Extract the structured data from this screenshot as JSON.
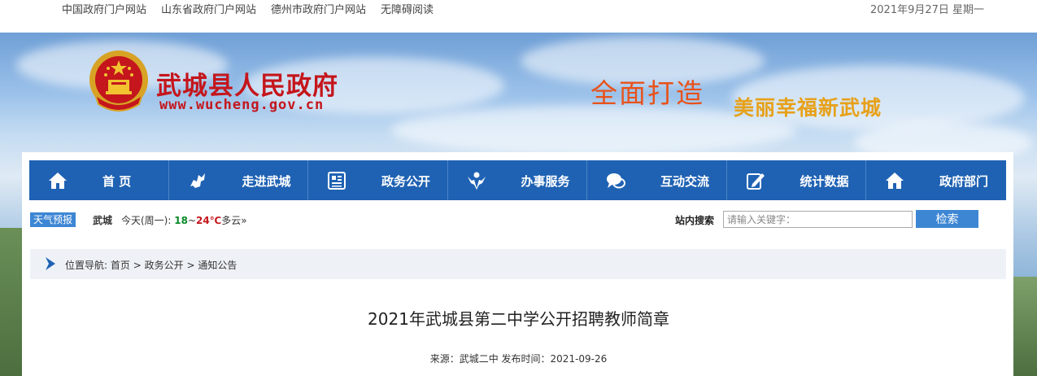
{
  "top_links": [
    "中国政府门户网站",
    "山东省政府门户网站",
    "德州市政府门户网站",
    "无障碍阅读"
  ],
  "date": "2021年9月27日 星期一",
  "site": {
    "title": "武城县人民政府",
    "url": "www.wucheng.gov.cn"
  },
  "slogan": {
    "line1": "全面打造",
    "line2": "美丽幸福新武城"
  },
  "nav": [
    {
      "label": "首 页",
      "icon": "home-icon"
    },
    {
      "label": "走进武城",
      "icon": "map-icon"
    },
    {
      "label": "政务公开",
      "icon": "document-icon"
    },
    {
      "label": "办事服务",
      "icon": "service-person-icon"
    },
    {
      "label": "互动交流",
      "icon": "chat-icon"
    },
    {
      "label": "统计数据",
      "icon": "edit-data-icon"
    },
    {
      "label": "政府部门",
      "icon": "building-icon"
    }
  ],
  "weather": {
    "tag": "天气预报",
    "city": "武城",
    "day": "今天(周一):",
    "low": "18",
    "sep": "~",
    "high": "24℃",
    "desc": "多云",
    "more": "»"
  },
  "search": {
    "label": "站内搜索",
    "placeholder": "请输入关键字：",
    "button": "检索"
  },
  "breadcrumb": {
    "prefix": "位置导航:",
    "items": [
      "首页",
      "政务公开",
      "通知公告"
    ],
    "sep": ">"
  },
  "article": {
    "title": "2021年武城县第二中学公开招聘教师简章",
    "meta": "来源：武城二中 发布时间：2021-09-26"
  },
  "colors": {
    "brand_red": "#c4161c",
    "nav_blue": "#1f62b3",
    "accent_blue": "#3d86d4",
    "slogan_orange": "#e8521a",
    "slogan_gold": "#e7a11a"
  }
}
